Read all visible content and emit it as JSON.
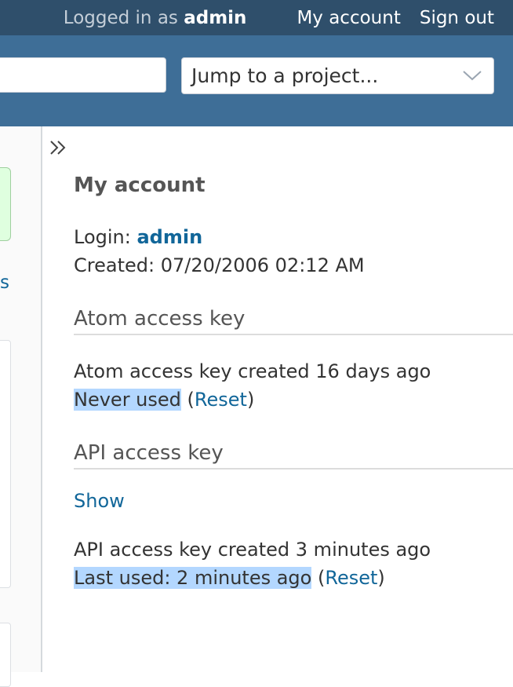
{
  "top_menu": {
    "logged_in_prefix": "Logged in as",
    "user": "admin",
    "my_account": "My account",
    "sign_out": "Sign out"
  },
  "header": {
    "project_jump_label": "Jump to a project..."
  },
  "sidebar": {
    "partial_link": "s"
  },
  "content": {
    "title": "My account",
    "login_label": "Login:",
    "login_value": "admin",
    "created_label": "Created:",
    "created_value": "07/20/2006 02:12 AM",
    "atom": {
      "heading": "Atom access key",
      "created_text": "Atom access key created 16 days ago",
      "usage": "Never used",
      "reset": "Reset"
    },
    "api": {
      "heading": "API access key",
      "show": "Show",
      "created_text": "API access key created 3 minutes ago",
      "usage": "Last used: 2 minutes ago",
      "reset": "Reset"
    }
  },
  "colors": {
    "top_bar": "#2f4f6b",
    "header": "#3e6e97",
    "link": "#116699",
    "selection": "#b3d7ff"
  }
}
